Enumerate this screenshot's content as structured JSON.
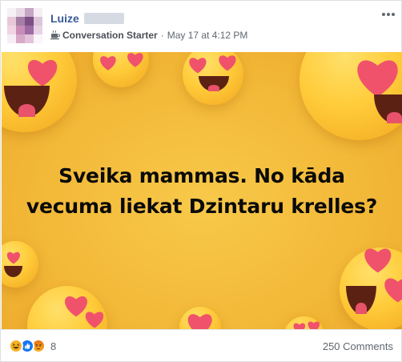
{
  "post": {
    "author_name": "Luize",
    "badge_label": "Conversation Starter",
    "separator": "·",
    "timestamp": "May 17 at 4:12 PM",
    "more_icon": "ellipsis-icon",
    "badge_icon": "coffee-cup-icon"
  },
  "image": {
    "caption_line1": "Sveika mammas. No kāda",
    "caption_line2": "vecuma liekat Dzintaru krelles?",
    "background_color": "#f3b938"
  },
  "footer": {
    "reactions": [
      "haha-icon",
      "like-icon",
      "angry-icon"
    ],
    "reaction_count": "8",
    "comments_label": "250 Comments"
  },
  "colors": {
    "author_link": "#385898",
    "meta_text": "#606770",
    "like_blue": "#1877f2"
  }
}
